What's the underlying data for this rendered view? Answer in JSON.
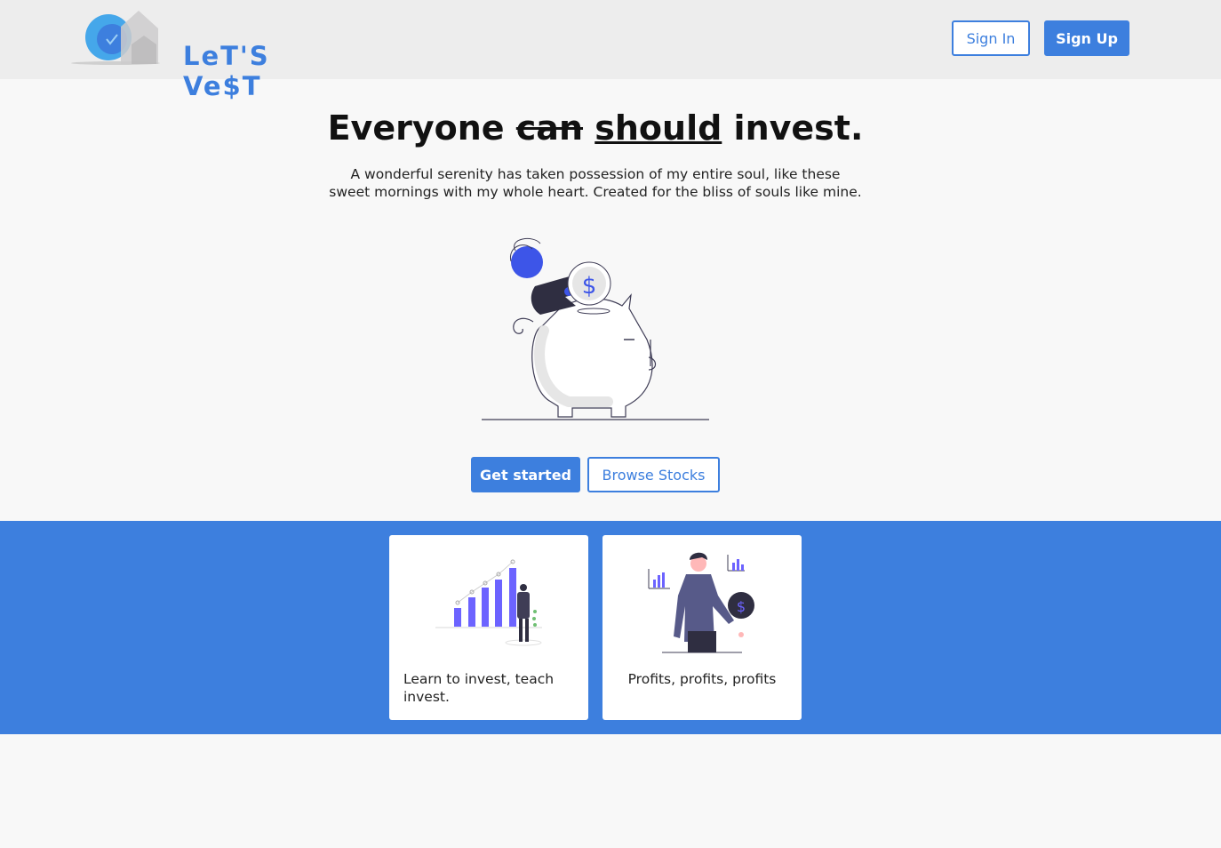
{
  "header": {
    "logo_text": "LeT'S Ve$T",
    "sign_in_label": "Sign In",
    "sign_up_label": "Sign Up"
  },
  "hero": {
    "title_prefix": "Everyone ",
    "title_struck": "can",
    "title_underlined": "should",
    "title_suffix": " invest.",
    "subtitle": "A wonderful serenity has taken possession of my entire soul, like these sweet mornings with my whole heart. Created for the bliss of souls like mine.",
    "coin_symbol": "$",
    "get_started_label": "Get started",
    "browse_stocks_label": "Browse Stocks"
  },
  "features": [
    {
      "text": "Learn to invest, teach invest.",
      "icon": "growth-chart-illustration"
    },
    {
      "text": "Profits, profits, profits",
      "icon": "businessman-coin-illustration",
      "coin_symbol": "$"
    }
  ],
  "colors": {
    "accent": "#3d7fde",
    "header_bg": "#ededed",
    "page_bg": "#f8f8f8",
    "illustration_purple": "#6c63ff",
    "dark": "#2f2e41"
  }
}
